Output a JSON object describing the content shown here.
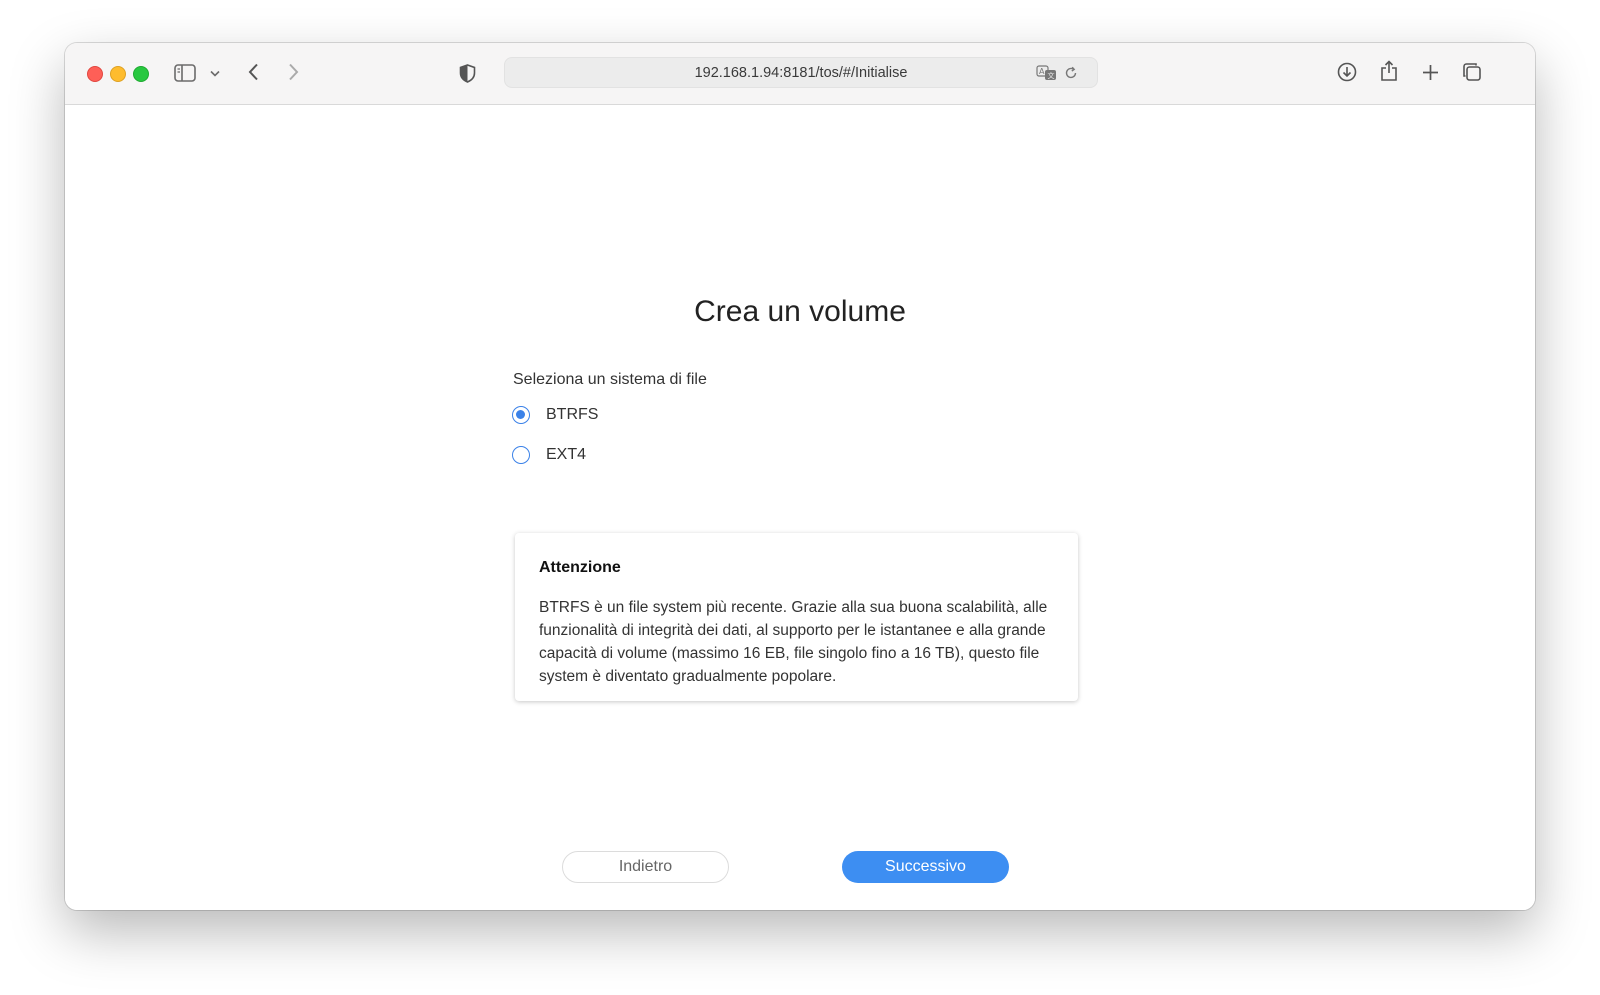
{
  "browser": {
    "url": "192.168.1.94:8181/tos/#/Initialise",
    "icons": {
      "sidebar": "sidebar-icon",
      "dropdown": "chevron-down-icon",
      "back": "chevron-left-icon",
      "forward": "chevron-right-icon",
      "privacy": "shield-icon",
      "translate": "translate-icon",
      "reload": "reload-icon",
      "download": "download-icon",
      "share": "share-icon",
      "new_tab": "plus-icon",
      "tabs": "tabs-overview-icon"
    }
  },
  "page": {
    "title": "Crea un volume",
    "fs_label": "Seleziona un sistema di file",
    "options": [
      {
        "label": "BTRFS",
        "selected": true
      },
      {
        "label": "EXT4",
        "selected": false
      }
    ],
    "warning": {
      "title": "Attenzione",
      "text": "BTRFS è un file system più recente. Grazie alla sua buona scalabilità, alle funzionalità di integrità dei dati, al supporto per le istantanee e alla grande capacità di volume (massimo 16 EB, file singolo fino a 16 TB), questo file system è diventato gradualmente popolare."
    },
    "buttons": {
      "back": "Indietro",
      "next": "Successivo"
    }
  },
  "colors": {
    "accent": "#3d8ef2",
    "radio": "#3b82e8"
  }
}
